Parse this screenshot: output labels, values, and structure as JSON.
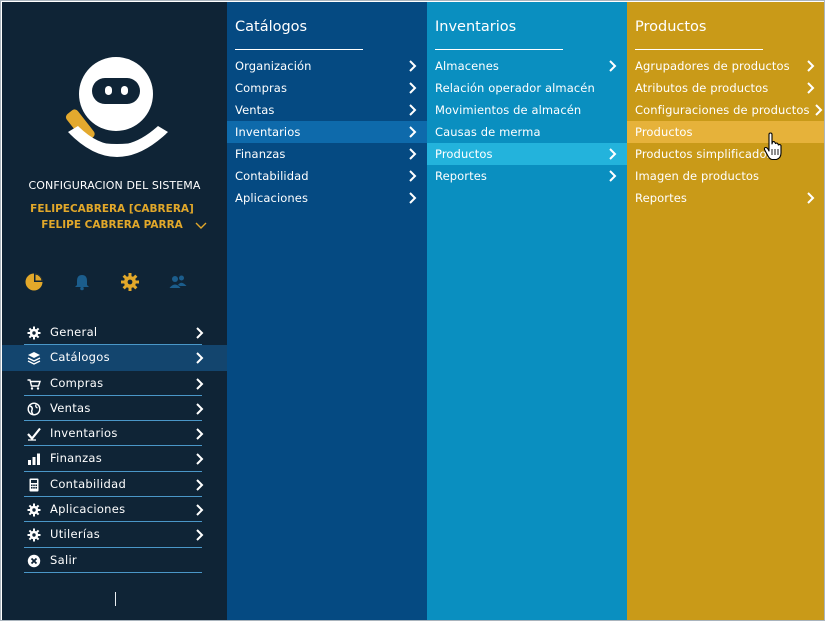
{
  "sidebar": {
    "system_title": "CONFIGURACION DEL SISTEMA",
    "user_line1": "FELIPECABRERA [CABRERA]",
    "user_line2": "FELIPE CABRERA PARRA",
    "quick_icons": [
      "dashboard-pie-icon",
      "bell-icon",
      "gear-icon",
      "users-icon"
    ],
    "items": [
      {
        "label": "General",
        "icon": "gear-icon",
        "has_arrow": true
      },
      {
        "label": "Catálogos",
        "icon": "layers-icon",
        "has_arrow": true,
        "active": true
      },
      {
        "label": "Compras",
        "icon": "cart-icon",
        "has_arrow": true
      },
      {
        "label": "Ventas",
        "icon": "globe-icon",
        "has_arrow": true
      },
      {
        "label": "Inventarios",
        "icon": "check-icon",
        "has_arrow": true
      },
      {
        "label": "Finanzas",
        "icon": "bar-chart-icon",
        "has_arrow": true
      },
      {
        "label": "Contabilidad",
        "icon": "calculator-icon",
        "has_arrow": true
      },
      {
        "label": "Aplicaciones",
        "icon": "gear-icon",
        "has_arrow": true
      },
      {
        "label": "Utilerías",
        "icon": "gear-icon",
        "has_arrow": true
      },
      {
        "label": "Salir",
        "icon": "close-circle-icon",
        "has_arrow": false
      }
    ]
  },
  "panels": [
    {
      "title": "Catálogos",
      "items": [
        {
          "label": "Organización",
          "arrow": true
        },
        {
          "label": "Compras",
          "arrow": true
        },
        {
          "label": "Ventas",
          "arrow": true
        },
        {
          "label": "Inventarios",
          "arrow": true,
          "active": true
        },
        {
          "label": "Finanzas",
          "arrow": true
        },
        {
          "label": "Contabilidad",
          "arrow": true
        },
        {
          "label": "Aplicaciones",
          "arrow": true
        }
      ]
    },
    {
      "title": "Inventarios",
      "items": [
        {
          "label": "Almacenes",
          "arrow": true
        },
        {
          "label": "Relación operador almacén",
          "arrow": false
        },
        {
          "label": "Movimientos de almacén",
          "arrow": false
        },
        {
          "label": "Causas de merma",
          "arrow": false
        },
        {
          "label": "Productos",
          "arrow": true,
          "active": true
        },
        {
          "label": "Reportes",
          "arrow": true
        }
      ]
    },
    {
      "title": "Productos",
      "items": [
        {
          "label": "Agrupadores de productos",
          "arrow": true
        },
        {
          "label": "Atributos de productos",
          "arrow": true
        },
        {
          "label": "Configuraciones de productos",
          "arrow": true
        },
        {
          "label": "Productos",
          "arrow": false,
          "active": true
        },
        {
          "label": "Productos simplificados",
          "arrow": false
        },
        {
          "label": "Imagen de productos",
          "arrow": false
        },
        {
          "label": "Reportes",
          "arrow": true
        }
      ]
    }
  ],
  "colors": {
    "sidebar_bg": "#0f2436",
    "sidebar_active": "#13456e",
    "panel1_bg": "#054a82",
    "panel2_bg": "#0a8fc0",
    "panel3_bg": "#c99a18",
    "accent_gold": "#e2a82a"
  }
}
